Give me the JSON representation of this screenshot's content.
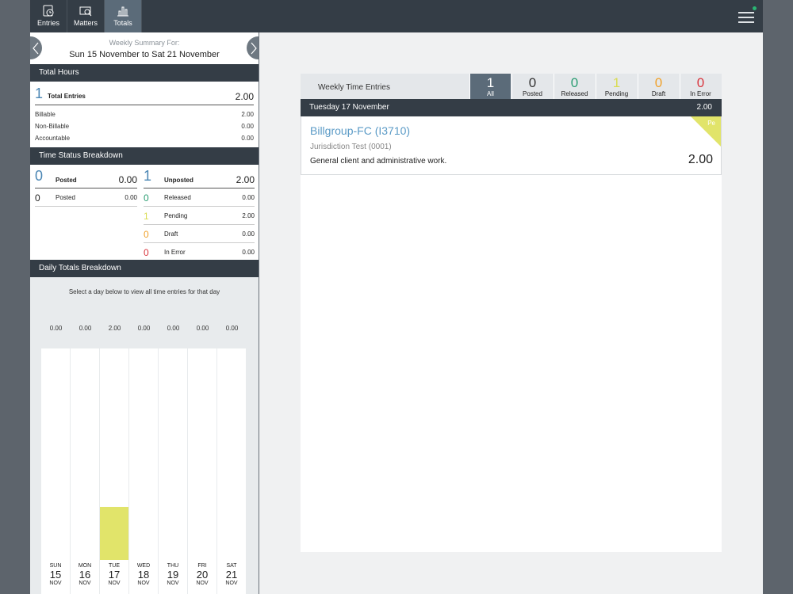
{
  "nav": {
    "tabs": [
      {
        "label": "Entries",
        "icon": "entries-icon",
        "active": false
      },
      {
        "label": "Matters",
        "icon": "matters-icon",
        "active": false
      },
      {
        "label": "Totals",
        "icon": "totals-icon",
        "active": true
      }
    ],
    "menu_icon": "hamburger-menu-icon",
    "notification_color": "#2ab573"
  },
  "summary": {
    "heading": "Weekly Summary For:",
    "range": "Sun 15 November to Sat 21 November"
  },
  "total_hours": {
    "header": "Total Hours",
    "count": "1",
    "label": "Total Entries",
    "value": "2.00",
    "rows": [
      {
        "label": "Billable",
        "value": "2.00"
      },
      {
        "label": "Non-Billable",
        "value": "0.00"
      },
      {
        "label": "Accountable",
        "value": "0.00"
      }
    ]
  },
  "status_breakdown": {
    "header": "Time Status Breakdown",
    "posted": {
      "count": "0",
      "label": "Posted",
      "value": "0.00",
      "rows": [
        {
          "count": "0",
          "label": "Posted",
          "value": "0.00"
        }
      ]
    },
    "unposted": {
      "count": "1",
      "label": "Unposted",
      "value": "2.00",
      "rows": [
        {
          "count": "0",
          "label": "Released",
          "value": "0.00",
          "color": "#2a9d72"
        },
        {
          "count": "1",
          "label": "Pending",
          "value": "2.00",
          "color": "#d9dc52"
        },
        {
          "count": "0",
          "label": "Draft",
          "value": "0.00",
          "color": "#f0a12a"
        },
        {
          "count": "0",
          "label": "In Error",
          "value": "0.00",
          "color": "#d9363e"
        }
      ]
    }
  },
  "daily": {
    "header": "Daily Totals Breakdown",
    "hint": "Select a day below to view all time entries for that day",
    "days": [
      {
        "dow": "SUN",
        "date": "15",
        "month": "NOV",
        "value": "0.00"
      },
      {
        "dow": "MON",
        "date": "16",
        "month": "NOV",
        "value": "0.00"
      },
      {
        "dow": "TUE",
        "date": "17",
        "month": "NOV",
        "value": "2.00"
      },
      {
        "dow": "WED",
        "date": "18",
        "month": "NOV",
        "value": "0.00"
      },
      {
        "dow": "THU",
        "date": "19",
        "month": "NOV",
        "value": "0.00"
      },
      {
        "dow": "FRI",
        "date": "20",
        "month": "NOV",
        "value": "0.00"
      },
      {
        "dow": "SAT",
        "date": "21",
        "month": "NOV",
        "value": "0.00"
      }
    ],
    "bar_color": "#e1e46a"
  },
  "weekly": {
    "title": "Weekly Time Entries",
    "filters": [
      {
        "count": "1",
        "label": "All",
        "color": "#ffffff",
        "active": true
      },
      {
        "count": "0",
        "label": "Posted",
        "color": "#333333",
        "active": false
      },
      {
        "count": "0",
        "label": "Released",
        "color": "#2a9d72",
        "active": false
      },
      {
        "count": "1",
        "label": "Pending",
        "color": "#d9dc52",
        "active": false
      },
      {
        "count": "0",
        "label": "Draft",
        "color": "#f0a12a",
        "active": false
      },
      {
        "count": "0",
        "label": "In Error",
        "color": "#d9363e",
        "active": false
      }
    ],
    "day_header": "Tuesday  17 November",
    "day_total": "2.00",
    "entry": {
      "client": "Billgroup-FC (I3710)",
      "matter": "Jurisdiction Test (0001)",
      "description": "General client and administrative work.",
      "hours": "2.00",
      "status_tag": "Pe"
    }
  }
}
